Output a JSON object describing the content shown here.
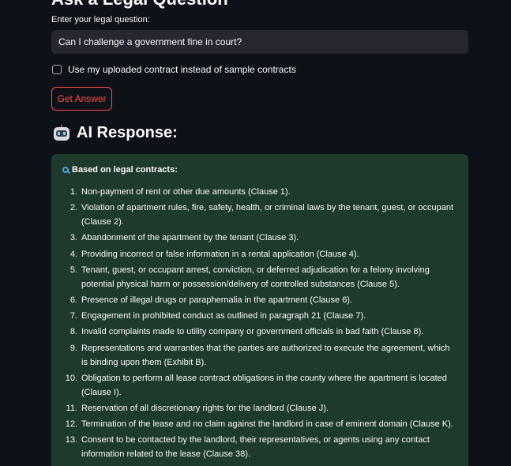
{
  "page": {
    "header_partial": "Ask a Legal Question"
  },
  "question": {
    "label": "Enter your legal question:",
    "value": "Can I challenge a government fine in court?"
  },
  "option": {
    "label": "Use my uploaded contract instead of sample contracts",
    "checked": false
  },
  "button": {
    "label": "Get Answer"
  },
  "response": {
    "heading": "AI Response:",
    "intro": "Based on legal contracts:",
    "items": [
      {
        "num": "1.",
        "text": "Non-payment of rent or other due amounts (Clause 1)."
      },
      {
        "num": "2.",
        "text": "Violation of apartment rules, fire, safety, health, or criminal laws by the tenant, guest, or occupant (Clause 2)."
      },
      {
        "num": "3.",
        "text": "Abandonment of the apartment by the tenant (Clause 3)."
      },
      {
        "num": "4.",
        "text": "Providing incorrect or false information in a rental application (Clause 4)."
      },
      {
        "num": "5.",
        "text": "Tenant, guest, or occupant arrest, conviction, or deferred adjudication for a felony involving potential physical harm or possession/delivery of controlled substances (Clause 5)."
      },
      {
        "num": "6.",
        "text": "Presence of illegal drugs or paraphernalia in the apartment (Clause 6)."
      },
      {
        "num": "7.",
        "text": "Engagement in prohibited conduct as outlined in paragraph 21 (Clause 7)."
      },
      {
        "num": "8.",
        "text": "Invalid complaints made to utility company or government officials in bad faith (Clause 8)."
      },
      {
        "num": "9.",
        "text": "Representations and warranties that the parties are authorized to execute the agreement, which is binding upon them (Exhibit B)."
      },
      {
        "num": "10.",
        "text": "Obligation to perform all lease contract obligations in the county where the apartment is located (Clause I)."
      },
      {
        "num": "11.",
        "text": "Reservation of all discretionary rights for the landlord (Clause J)."
      },
      {
        "num": "12.",
        "text": "Termination of the lease and no claim against the landlord in case of eminent domain (Clause K)."
      },
      {
        "num": "13.",
        "text": "Consent to be contacted by the landlord, their representatives, or agents using any contact information related to the lease (Clause 38)."
      }
    ]
  },
  "colors": {
    "background": "#0e1117",
    "input_bg": "#262730",
    "accent": "#ff4b4b",
    "response_bg": "#1e3a2c"
  }
}
